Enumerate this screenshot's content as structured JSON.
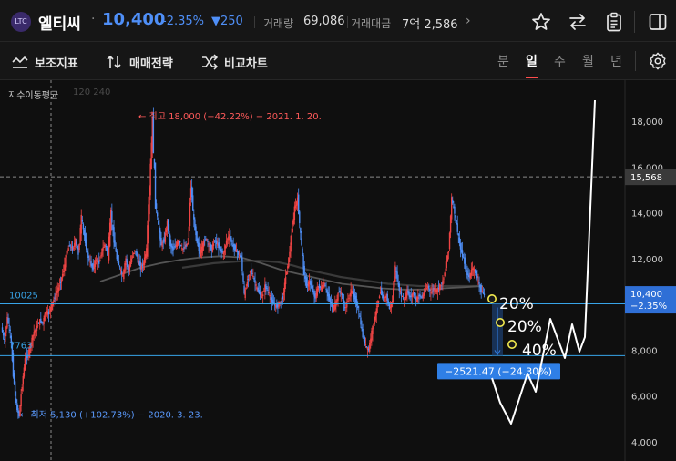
{
  "header": {
    "logo_text": "LTC",
    "stock_name": "엘티씨",
    "separator": "·",
    "price": "10,400",
    "change_rate": "-2.35%",
    "change_abs": "▼250",
    "volume_label": "거래량",
    "volume_value": "69,086",
    "amount_label": "거래대금",
    "amount_value": "7억 2,586",
    "more": "›",
    "icons": [
      "star-icon",
      "swap-icon",
      "clipboard-icon",
      "panel-icon"
    ]
  },
  "toolbar": {
    "indicator_label": "보조지표",
    "strategy_label": "매매전략",
    "compare_label": "비교차트",
    "periods": [
      "분",
      "일",
      "주",
      "월",
      "년"
    ],
    "active_period": "일",
    "settings_icon": "gear-icon"
  },
  "chart": {
    "ma_label": "지수이동평균",
    "ma_params": "120 240",
    "high_annotation": "← 최고 18,000 (−42.22%) − 2021. 1. 20.",
    "low_annotation": "← 최저 5,130 (+102.73%) − 2020. 3. 23.",
    "line_level_upper": "10025",
    "line_level_lower": "7763",
    "measure_label": "−2521.47 (−24.30%)",
    "pct_labels": [
      "20%",
      "20%",
      "40%"
    ],
    "current_price_tag": "10,400",
    "current_rate_tag": "−2.35%",
    "crosshair_price_tag": "15,568",
    "colors": {
      "up": "#ef4444",
      "down": "#4f8ff7",
      "hline": "#38a4e8",
      "measure_box": "#2f7fe6",
      "annotation_high": "#ff5a5a",
      "annotation_low": "#5b9bff",
      "circle": "#f2e94e"
    }
  },
  "chart_data": {
    "type": "candlestick",
    "yticks": [
      "18,000",
      "16,000",
      "14,000",
      "12,000",
      "8,000",
      "6,000",
      "4,000"
    ],
    "ylim": [
      3800,
      19600
    ],
    "close_series": [
      9000,
      8400,
      9400,
      8800,
      7000,
      5600,
      5130,
      6500,
      7600,
      7800,
      8300,
      8800,
      9000,
      9300,
      9200,
      9700,
      9600,
      10000,
      10300,
      10600,
      11000,
      11500,
      12200,
      12600,
      12400,
      12800,
      12200,
      13800,
      13000,
      12200,
      11800,
      11600,
      12000,
      11800,
      12400,
      12600,
      12200,
      14000,
      12800,
      12000,
      11600,
      11200,
      12000,
      11500,
      12000,
      12400,
      12000,
      11600,
      11800,
      12400,
      15000,
      18000,
      14500,
      13400,
      12600,
      12800,
      13600,
      12600,
      12400,
      12600,
      12800,
      12400,
      12500,
      12700,
      15200,
      13600,
      12800,
      12200,
      12600,
      12900,
      12600,
      12400,
      12800,
      12600,
      12400,
      12200,
      12800,
      13000,
      12600,
      12400,
      12200,
      12000,
      10400,
      11000,
      11500,
      11200,
      10800,
      10500,
      10300,
      10800,
      10600,
      10200,
      10000,
      9900,
      10100,
      10300,
      11200,
      12000,
      13000,
      14200,
      14600,
      13000,
      11600,
      10800,
      11000,
      10600,
      10300,
      10800,
      10700,
      10900,
      10500,
      10100,
      9800,
      10100,
      10600,
      10400,
      9800,
      10200,
      10600,
      10400,
      10000,
      9400,
      8600,
      8200,
      8000,
      8800,
      9400,
      10000,
      10600,
      10200,
      10400,
      9800,
      10200,
      11600,
      10800,
      10400,
      10200,
      10600,
      10300,
      10500,
      10200,
      10400,
      10300,
      10600,
      10800,
      10500,
      10700,
      10600,
      10800,
      11000,
      11600,
      12400,
      14600,
      14000,
      13200,
      12400,
      12000,
      11400,
      11200,
      11600,
      11400,
      11000,
      10600,
      10400
    ],
    "ma120": [
      11000,
      11300,
      11600,
      11800,
      11950,
      12050,
      12100,
      12050,
      11800,
      11500,
      11300,
      11100,
      10900,
      10800,
      10700,
      10650,
      10650,
      10700,
      10750,
      10800
    ],
    "ma240": [
      11600,
      11700,
      11800,
      11850,
      11900,
      11900,
      11850,
      11700,
      11500,
      11350,
      11200,
      11100,
      11000,
      10900,
      10850,
      10800,
      10800,
      10800,
      10800,
      10800
    ],
    "projection": [
      10400,
      9700,
      8900,
      10600,
      10000,
      11400,
      10600,
      12800,
      11600,
      12700,
      11500,
      19000
    ],
    "high_value": 18000,
    "low_value": 5130,
    "upper_level": 10025,
    "lower_level": 7763,
    "crosshair_level": 15568,
    "current_price": 10400
  }
}
